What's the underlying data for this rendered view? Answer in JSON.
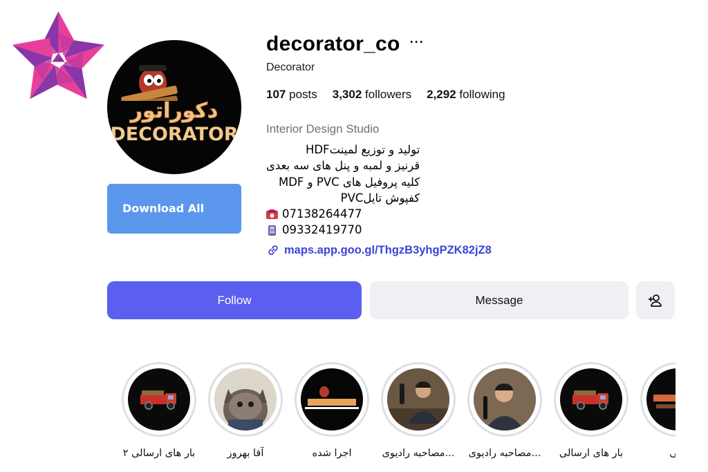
{
  "profile": {
    "username": "decorator_co",
    "more_icon": "···",
    "category": "Decorator",
    "avatar_text_fa": "دکوراتور",
    "avatar_text_en": "DECORATOR"
  },
  "download_button": {
    "label": "Download All"
  },
  "stats": {
    "posts_count": "107",
    "posts_label": "posts",
    "followers_count": "3,302",
    "followers_label": "followers",
    "following_count": "2,292",
    "following_label": "following"
  },
  "bio": {
    "category": "Interior Design Studio",
    "lines": [
      "تولید و توزیع لمینتHDF",
      "قرنیز و لمبه و پنل های سه بعدی",
      "کلیه پروفیل های PVC و MDF",
      "کفپوش تایلPVC"
    ],
    "phone": "07138264477",
    "mobile": "09332419770",
    "link": "maps.app.goo.gl/ThgzB3yhgPZK82jZ8"
  },
  "actions": {
    "follow_label": "Follow",
    "message_label": "Message",
    "add_user_icon": "person-add-icon"
  },
  "highlights": [
    {
      "label": "بار های ارسالی ۲"
    },
    {
      "label": "آقا بهروز"
    },
    {
      "label": "اجرا شده"
    },
    {
      "label": "مصاحبه رادیوی..."
    },
    {
      "label": "مصاحبه رادیوی..."
    },
    {
      "label": "بار های ارسالی"
    },
    {
      "label": "کتی"
    }
  ],
  "colors": {
    "follow": "#5b5ff0",
    "download": "#5b97ed",
    "link": "#3a44d6",
    "secondary_button": "#eff0f3"
  }
}
